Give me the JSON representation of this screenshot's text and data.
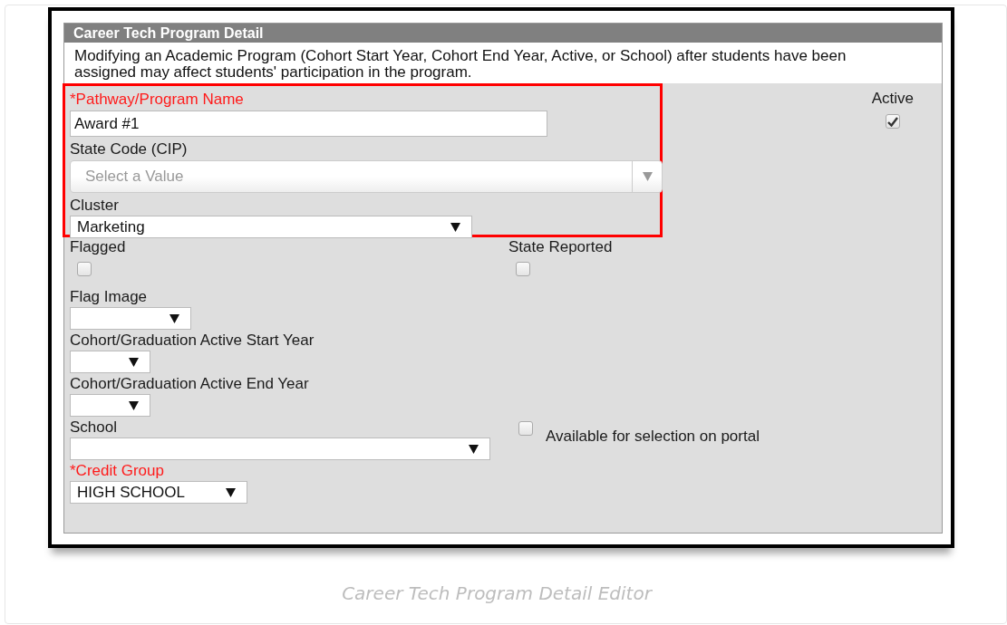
{
  "panel": {
    "title": "Career Tech Program Detail",
    "notice": "Modifying an Academic Program (Cohort Start Year, Cohort End Year, Active, or School) after students have been assigned may affect students' participation in the program."
  },
  "program_name": {
    "label": "*Pathway/Program Name",
    "required": true,
    "value": "Award #1"
  },
  "active": {
    "label": "Active",
    "checked": true
  },
  "state_code": {
    "label": "State Code (CIP)",
    "placeholder": "Select a Value"
  },
  "cluster": {
    "label": "Cluster",
    "value": "Marketing"
  },
  "flagged": {
    "label": "Flagged",
    "checked": false
  },
  "state_reported": {
    "label": "State Reported",
    "checked": false
  },
  "flag_image": {
    "label": "Flag Image"
  },
  "start_year": {
    "label": "Cohort/Graduation Active Start Year"
  },
  "end_year": {
    "label": "Cohort/Graduation Active End Year"
  },
  "school": {
    "label": "School"
  },
  "portal": {
    "label": "Available for selection on portal",
    "checked": false
  },
  "credit_group": {
    "label": "*Credit Group",
    "required": true,
    "value": "HIGH SCHOOL"
  },
  "caption": "Career Tech Program Detail Editor"
}
